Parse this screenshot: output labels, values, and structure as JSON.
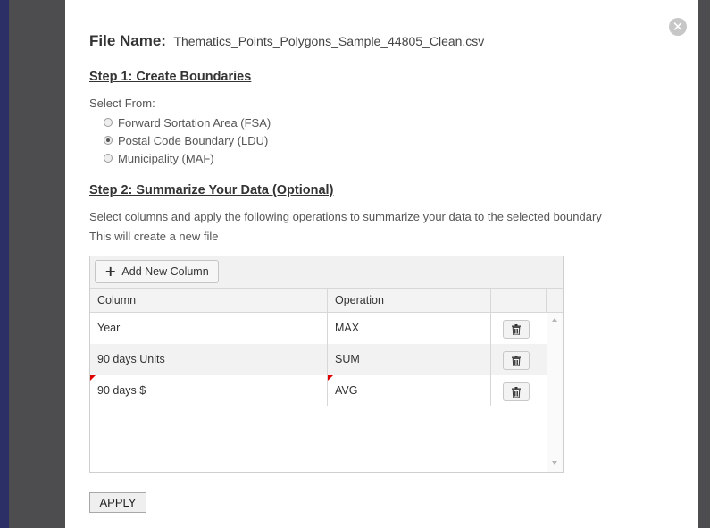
{
  "dialog": {
    "close_symbol": "✕",
    "file_label": "File Name:",
    "file_name": "Thematics_Points_Polygons_Sample_44805_Clean.csv"
  },
  "step1": {
    "heading": "Step 1: Create Boundaries",
    "select_from": "Select From:",
    "options": [
      {
        "label": "Forward Sortation Area (FSA)",
        "selected": false
      },
      {
        "label": "Postal Code Boundary (LDU)",
        "selected": true
      },
      {
        "label": "Municipality (MAF)",
        "selected": false
      }
    ]
  },
  "step2": {
    "heading": "Step 2: Summarize Your Data (Optional)",
    "description": "Select columns and apply the following operations to summarize your data to the selected boundary",
    "note": "This will create a new file",
    "add_button": "Add New Column",
    "columns": {
      "column": "Column",
      "operation": "Operation"
    },
    "rows": [
      {
        "column": "Year",
        "operation": "MAX"
      },
      {
        "column": "90 days Units",
        "operation": "SUM"
      },
      {
        "column": "90 days $",
        "operation": "AVG"
      }
    ],
    "apply_button": "APPLY"
  },
  "icons": {
    "close": "close-icon",
    "plus": "plus-icon",
    "trash": "trash-icon"
  },
  "colors": {
    "dirty_marker": "#e00000",
    "sidebar_strip": "#2c2f66"
  }
}
